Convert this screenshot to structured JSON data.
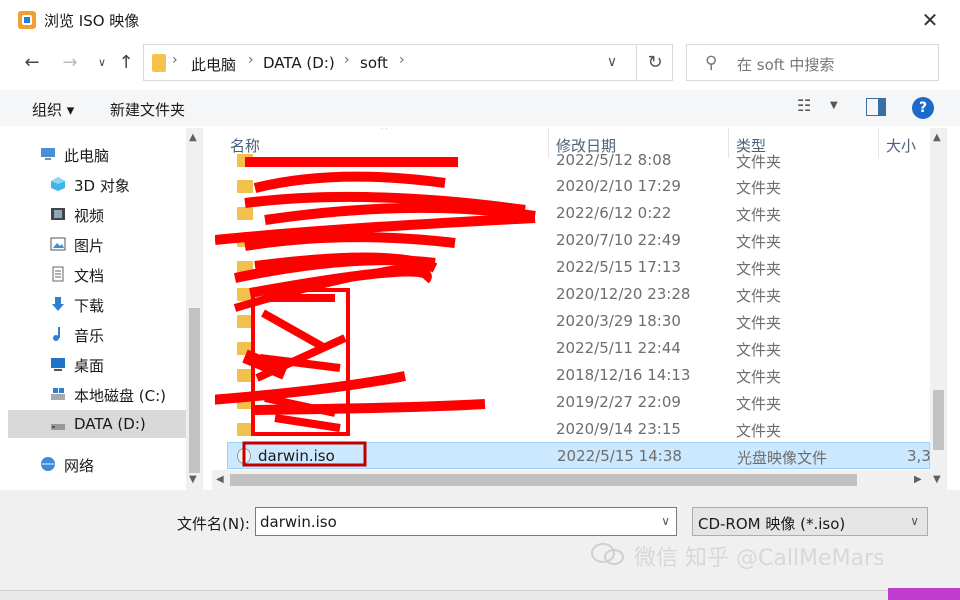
{
  "window": {
    "title": "浏览 ISO 映像",
    "close_glyph": "✕"
  },
  "address": {
    "crumbs": [
      "此电脑",
      "DATA (D:)",
      "soft"
    ],
    "search_placeholder": "在 soft 中搜索"
  },
  "toolbar": {
    "organize": "组织 ▾",
    "new_folder": "新建文件夹"
  },
  "nav": {
    "items": [
      {
        "label": "此电脑",
        "icon": "computer-icon"
      },
      {
        "label": "3D 对象",
        "icon": "cube-icon"
      },
      {
        "label": "视频",
        "icon": "video-icon"
      },
      {
        "label": "图片",
        "icon": "picture-icon"
      },
      {
        "label": "文档",
        "icon": "document-icon"
      },
      {
        "label": "下载",
        "icon": "download-icon"
      },
      {
        "label": "音乐",
        "icon": "music-icon"
      },
      {
        "label": "桌面",
        "icon": "desktop-icon"
      },
      {
        "label": "本地磁盘 (C:)",
        "icon": "drive-icon"
      },
      {
        "label": "DATA (D:)",
        "icon": "drive-icon"
      },
      {
        "label": "网络",
        "icon": "network-icon"
      }
    ],
    "selected": "DATA (D:)"
  },
  "columns": {
    "name": "名称",
    "date": "修改日期",
    "type": "类型",
    "size": "大小"
  },
  "files": [
    {
      "name": "",
      "date": "2022/5/12 8:08",
      "type": "文件夹"
    },
    {
      "name": "",
      "date": "2020/2/10 17:29",
      "type": "文件夹"
    },
    {
      "name": "",
      "date": "2022/6/12 0:22",
      "type": "文件夹"
    },
    {
      "name": "",
      "date": "2020/7/10 22:49",
      "type": "文件夹"
    },
    {
      "name": "",
      "date": "2022/5/15 17:13",
      "type": "文件夹"
    },
    {
      "name": "",
      "date": "2020/12/20 23:28",
      "type": "文件夹"
    },
    {
      "name": "",
      "date": "2020/3/29 18:30",
      "type": "文件夹"
    },
    {
      "name": "",
      "date": "2022/5/11 22:44",
      "type": "文件夹"
    },
    {
      "name": "",
      "date": "2018/12/16 14:13",
      "type": "文件夹"
    },
    {
      "name": "",
      "date": "2019/2/27 22:09",
      "type": "文件夹"
    },
    {
      "name": "",
      "date": "2020/9/14 23:15",
      "type": "文件夹"
    },
    {
      "name": "darwin.iso",
      "date": "2022/5/15 14:38",
      "type": "光盘映像文件",
      "size": "3,3"
    }
  ],
  "filename": {
    "label": "文件名(N):",
    "value": "darwin.iso"
  },
  "filetype": {
    "value": "CD-ROM 映像 (*.iso)"
  },
  "watermark": "微信 知乎 @CallMeMars",
  "colors": {
    "selection": "#cce8ff",
    "accent": "#1c6ac9",
    "redaction": "#ff0000"
  }
}
